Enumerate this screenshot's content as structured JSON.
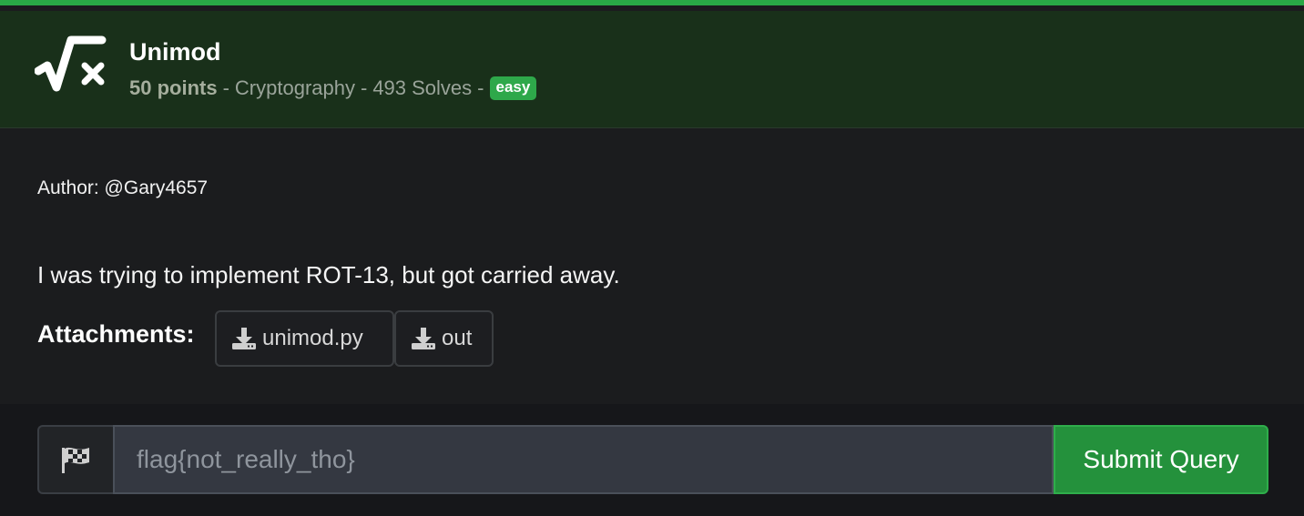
{
  "challenge": {
    "title": "Unimod",
    "points": "50 points",
    "category": "Cryptography",
    "solves": "493 Solves",
    "difficulty": "easy",
    "accent_color": "#29a846",
    "logo_icon": "square-root-times-icon"
  },
  "content": {
    "author": "Author: @Gary4657",
    "description": "I was trying to implement ROT-13, but got carried away.",
    "attachments_label": "Attachments:",
    "attachments": [
      {
        "name": "unimod.py",
        "icon": "download-icon"
      },
      {
        "name": "out",
        "icon": "download-icon"
      }
    ]
  },
  "submission": {
    "flag_icon": "checkered-flag-icon",
    "input_value": "",
    "input_placeholder": "flag{not_really_tho}",
    "submit_label": "Submit Query"
  },
  "separator": "-"
}
